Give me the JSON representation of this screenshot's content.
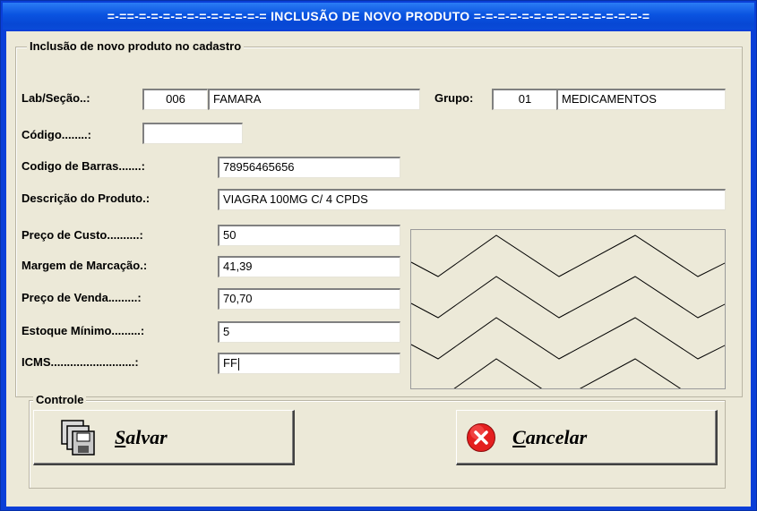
{
  "window": {
    "title": "=-==-=-=-=-=-=-=-=-=-=-=-= INCLUSÃO DE NOVO PRODUTO =-=-=-=-=-=-=-=-=-=-=-=-=-=-="
  },
  "form": {
    "group_title": "Inclusão de novo produto no cadastro",
    "lab_secao": {
      "label": "Lab/Seção..:",
      "code": "006",
      "name": "FAMARA"
    },
    "grupo": {
      "label": "Grupo:",
      "code": "01",
      "name": "MEDICAMENTOS"
    },
    "codigo": {
      "label": "Código........:",
      "value": ""
    },
    "codigo_barras": {
      "label": "Codigo de Barras.......:",
      "value": "78956465656"
    },
    "descricao": {
      "label": "Descrição do Produto.:",
      "value": "VIAGRA 100MG C/ 4 CPDS"
    },
    "preco_custo": {
      "label": "Preço de Custo..........:",
      "value": "50"
    },
    "margem": {
      "label": "Margem de Marcação.:",
      "value": "41,39"
    },
    "preco_venda": {
      "label": "Preço de Venda.........:",
      "value": "70,70"
    },
    "estoque_minimo": {
      "label": "Estoque Mínimo.........:",
      "value": "5"
    },
    "icms": {
      "label": "ICMS..........................:",
      "value": "FF"
    }
  },
  "controle": {
    "group_title": "Controle",
    "save": {
      "label_first": "S",
      "label_rest": "alvar",
      "icon": "floppy-disks-icon"
    },
    "cancel": {
      "label_first": "C",
      "label_rest": "ancelar",
      "icon": "red-x-circle-icon",
      "icon_color": "#e41f1f"
    }
  }
}
